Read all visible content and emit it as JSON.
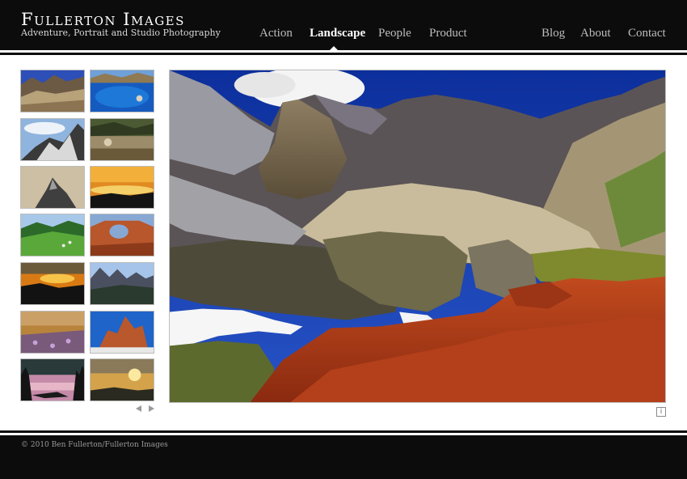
{
  "site": {
    "title": "Fullerton Images",
    "tagline": "Adventure, Portrait and Studio Photography"
  },
  "nav": {
    "primary": [
      {
        "label": "Action",
        "active": false
      },
      {
        "label": "Landscape",
        "active": true
      },
      {
        "label": "People",
        "active": false
      },
      {
        "label": "Product",
        "active": false
      }
    ],
    "secondary": [
      {
        "label": "Blog"
      },
      {
        "label": "About"
      },
      {
        "label": "Contact"
      }
    ]
  },
  "gallery": {
    "thumbnail_count": 14,
    "selected_index": 0,
    "prev_icon": "triangle-left-icon",
    "next_icon": "triangle-right-icon",
    "info_icon": "info-icon",
    "info_glyph": "i"
  },
  "footer": {
    "copyright": "© 2010 Ben Fullerton/Fullerton Images"
  },
  "colors": {
    "header_bg": "#0c0c0c",
    "page_bg": "#ffffff",
    "nav_inactive": "#bdbdbd",
    "nav_active": "#ffffff",
    "sky_blue": "#1c3fb8",
    "foliage_red": "#b8421c"
  }
}
